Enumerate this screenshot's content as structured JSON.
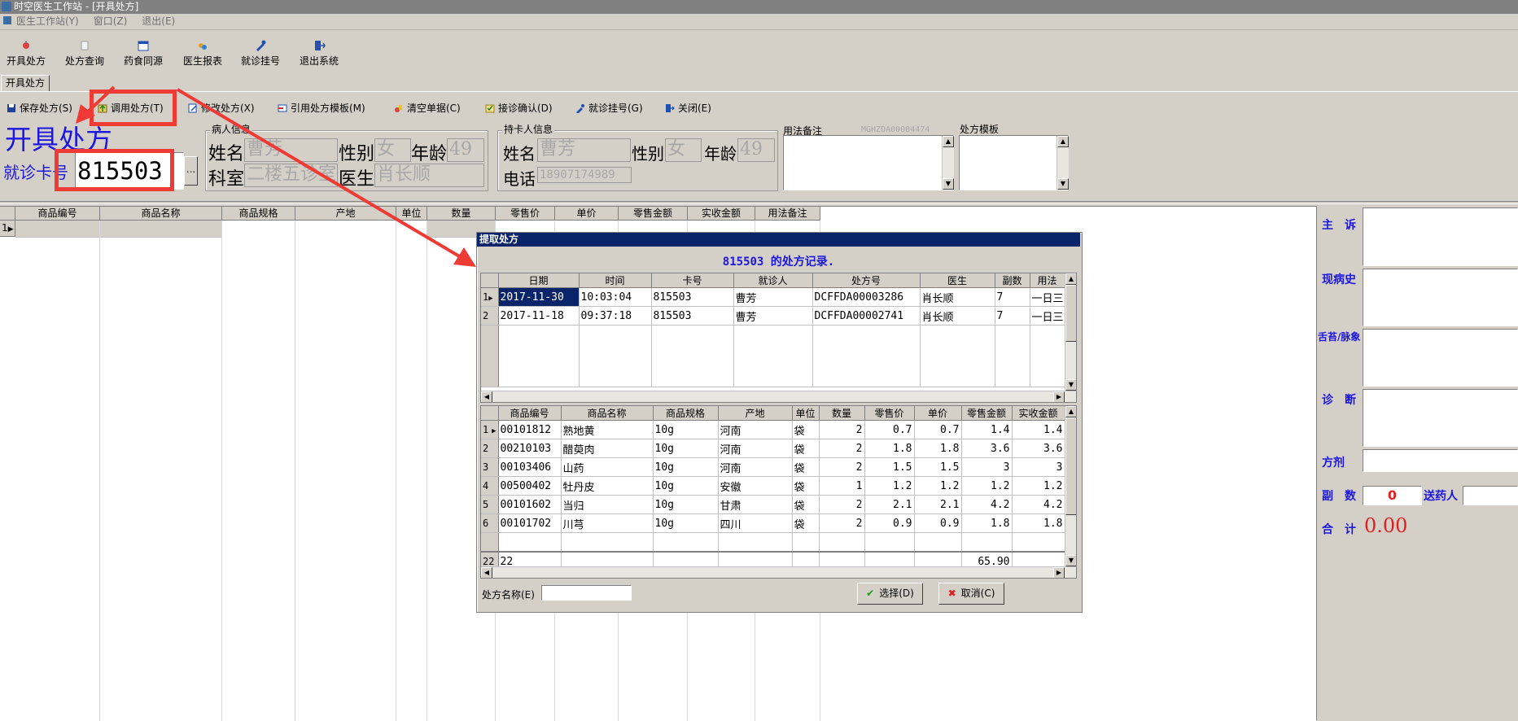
{
  "window": {
    "title": "时空医生工作站 - [开具处方]"
  },
  "menubar": {
    "items": [
      "医生工作站(Y)",
      "窗口(Z)",
      "退出(E)"
    ]
  },
  "main_toolbar": {
    "items": [
      {
        "label": "开具处方",
        "icon": "prescription-icon"
      },
      {
        "label": "处方查询",
        "icon": "query-icon"
      },
      {
        "label": "药食同源",
        "icon": "calendar-icon"
      },
      {
        "label": "医生报表",
        "icon": "report-icon"
      },
      {
        "label": "就诊挂号",
        "icon": "register-icon"
      },
      {
        "label": "退出系统",
        "icon": "exit-icon"
      }
    ]
  },
  "tab": {
    "label": "开具处方"
  },
  "action_toolbar": {
    "items": [
      {
        "label": "保存处方(S)",
        "icon": "save-icon"
      },
      {
        "label": "调用处方(T)",
        "icon": "load-icon"
      },
      {
        "label": "修改处方(X)",
        "icon": "edit-icon"
      },
      {
        "label": "引用处方模板(M)",
        "icon": "template-icon"
      },
      {
        "label": "清空单据(C)",
        "icon": "clear-icon"
      },
      {
        "label": "接诊确认(D)",
        "icon": "confirm-icon"
      },
      {
        "label": "就诊挂号(G)",
        "icon": "register-icon"
      },
      {
        "label": "关闭(E)",
        "icon": "close-icon"
      }
    ]
  },
  "form": {
    "title": "开具处方",
    "card_label": "就诊卡号",
    "card_value": "815503",
    "browse_label": "...",
    "patient_group": "病人信息",
    "name_label": "姓名",
    "name_value": "曹芳",
    "sex_label": "性别",
    "sex_value": "女",
    "age_label": "年龄",
    "age_value": "49",
    "dept_label": "科室",
    "dept_value": "二楼五诊室",
    "doctor_label": "医生",
    "doctor_value": "肖长顺",
    "holder_group": "持卡人信息",
    "h_name_label": "姓名",
    "h_name_value": "曹芳",
    "h_sex_label": "性别",
    "h_sex_value": "女",
    "h_age_label": "年龄",
    "h_age_value": "49",
    "phone_label": "电话",
    "phone_value": "18907174989",
    "usage_label": "用法备注",
    "usage_code": "MGHZDA00004474",
    "template_label": "处方模板"
  },
  "main_grid": {
    "columns": [
      "商品编号",
      "商品名称",
      "商品规格",
      "产地",
      "单位",
      "数量",
      "零售价",
      "单价",
      "零售金额",
      "实收金额",
      "用法备注"
    ],
    "row_number": "1"
  },
  "right_panel": {
    "complaint": "主　诉",
    "history": "现病史",
    "tongue": "舌苔/脉象",
    "diagnosis": "诊　断",
    "formula": "方剂",
    "doses_label": "副　数",
    "doses_value": "0",
    "sender_label": "送药人",
    "total_label": "合　计",
    "total_value": "0.00"
  },
  "dialog": {
    "title": "提取处方",
    "heading": "815503 的处方记录.",
    "records_columns": [
      "日期",
      "时间",
      "卡号",
      "就诊人",
      "处方号",
      "医生",
      "副数",
      "用法"
    ],
    "records": [
      {
        "n": "1",
        "date": "2017-11-30",
        "time": "10:03:04",
        "card": "815503",
        "patient": "曹芳",
        "rx": "DCFFDA00003286",
        "doctor": "肖长顺",
        "doses": "7",
        "usage": "一日三"
      },
      {
        "n": "2",
        "date": "2017-11-18",
        "time": "09:37:18",
        "card": "815503",
        "patient": "曹芳",
        "rx": "DCFFDA00002741",
        "doctor": "肖长顺",
        "doses": "7",
        "usage": "一日三"
      }
    ],
    "items_columns": [
      "商品编号",
      "商品名称",
      "商品规格",
      "产地",
      "单位",
      "数量",
      "零售价",
      "单价",
      "零售金额",
      "实收金额"
    ],
    "items": [
      {
        "n": "1",
        "code": "00101812",
        "name": "熟地黄",
        "spec": "10g",
        "origin": "河南",
        "unit": "袋",
        "qty": "2",
        "retail": "0.7",
        "price": "0.7",
        "amount": "1.4",
        "paid": "1.4"
      },
      {
        "n": "2",
        "code": "00210103",
        "name": "醋萸肉",
        "spec": "10g",
        "origin": "河南",
        "unit": "袋",
        "qty": "2",
        "retail": "1.8",
        "price": "1.8",
        "amount": "3.6",
        "paid": "3.6"
      },
      {
        "n": "3",
        "code": "00103406",
        "name": "山药",
        "spec": "10g",
        "origin": "河南",
        "unit": "袋",
        "qty": "2",
        "retail": "1.5",
        "price": "1.5",
        "amount": "3",
        "paid": "3"
      },
      {
        "n": "4",
        "code": "00500402",
        "name": "牡丹皮",
        "spec": "10g",
        "origin": "安徽",
        "unit": "袋",
        "qty": "1",
        "retail": "1.2",
        "price": "1.2",
        "amount": "1.2",
        "paid": "1.2"
      },
      {
        "n": "5",
        "code": "00101602",
        "name": "当归",
        "spec": "10g",
        "origin": "甘肃",
        "unit": "袋",
        "qty": "2",
        "retail": "2.1",
        "price": "2.1",
        "amount": "4.2",
        "paid": "4.2"
      },
      {
        "n": "6",
        "code": "00101702",
        "name": "川芎",
        "spec": "10g",
        "origin": "四川",
        "unit": "袋",
        "qty": "2",
        "retail": "0.9",
        "price": "0.9",
        "amount": "1.8",
        "paid": "1.8"
      }
    ],
    "footer_row": {
      "n": "22",
      "count": "22",
      "total": "65.90"
    },
    "rx_name_label": "处方名称(E)",
    "select_label": "选择(D)",
    "cancel_label": "取消(C)"
  },
  "colors": {
    "annotation": "#ef3b36",
    "accent_blue": "#1c16e0",
    "dialog_title": "#0a246a"
  }
}
